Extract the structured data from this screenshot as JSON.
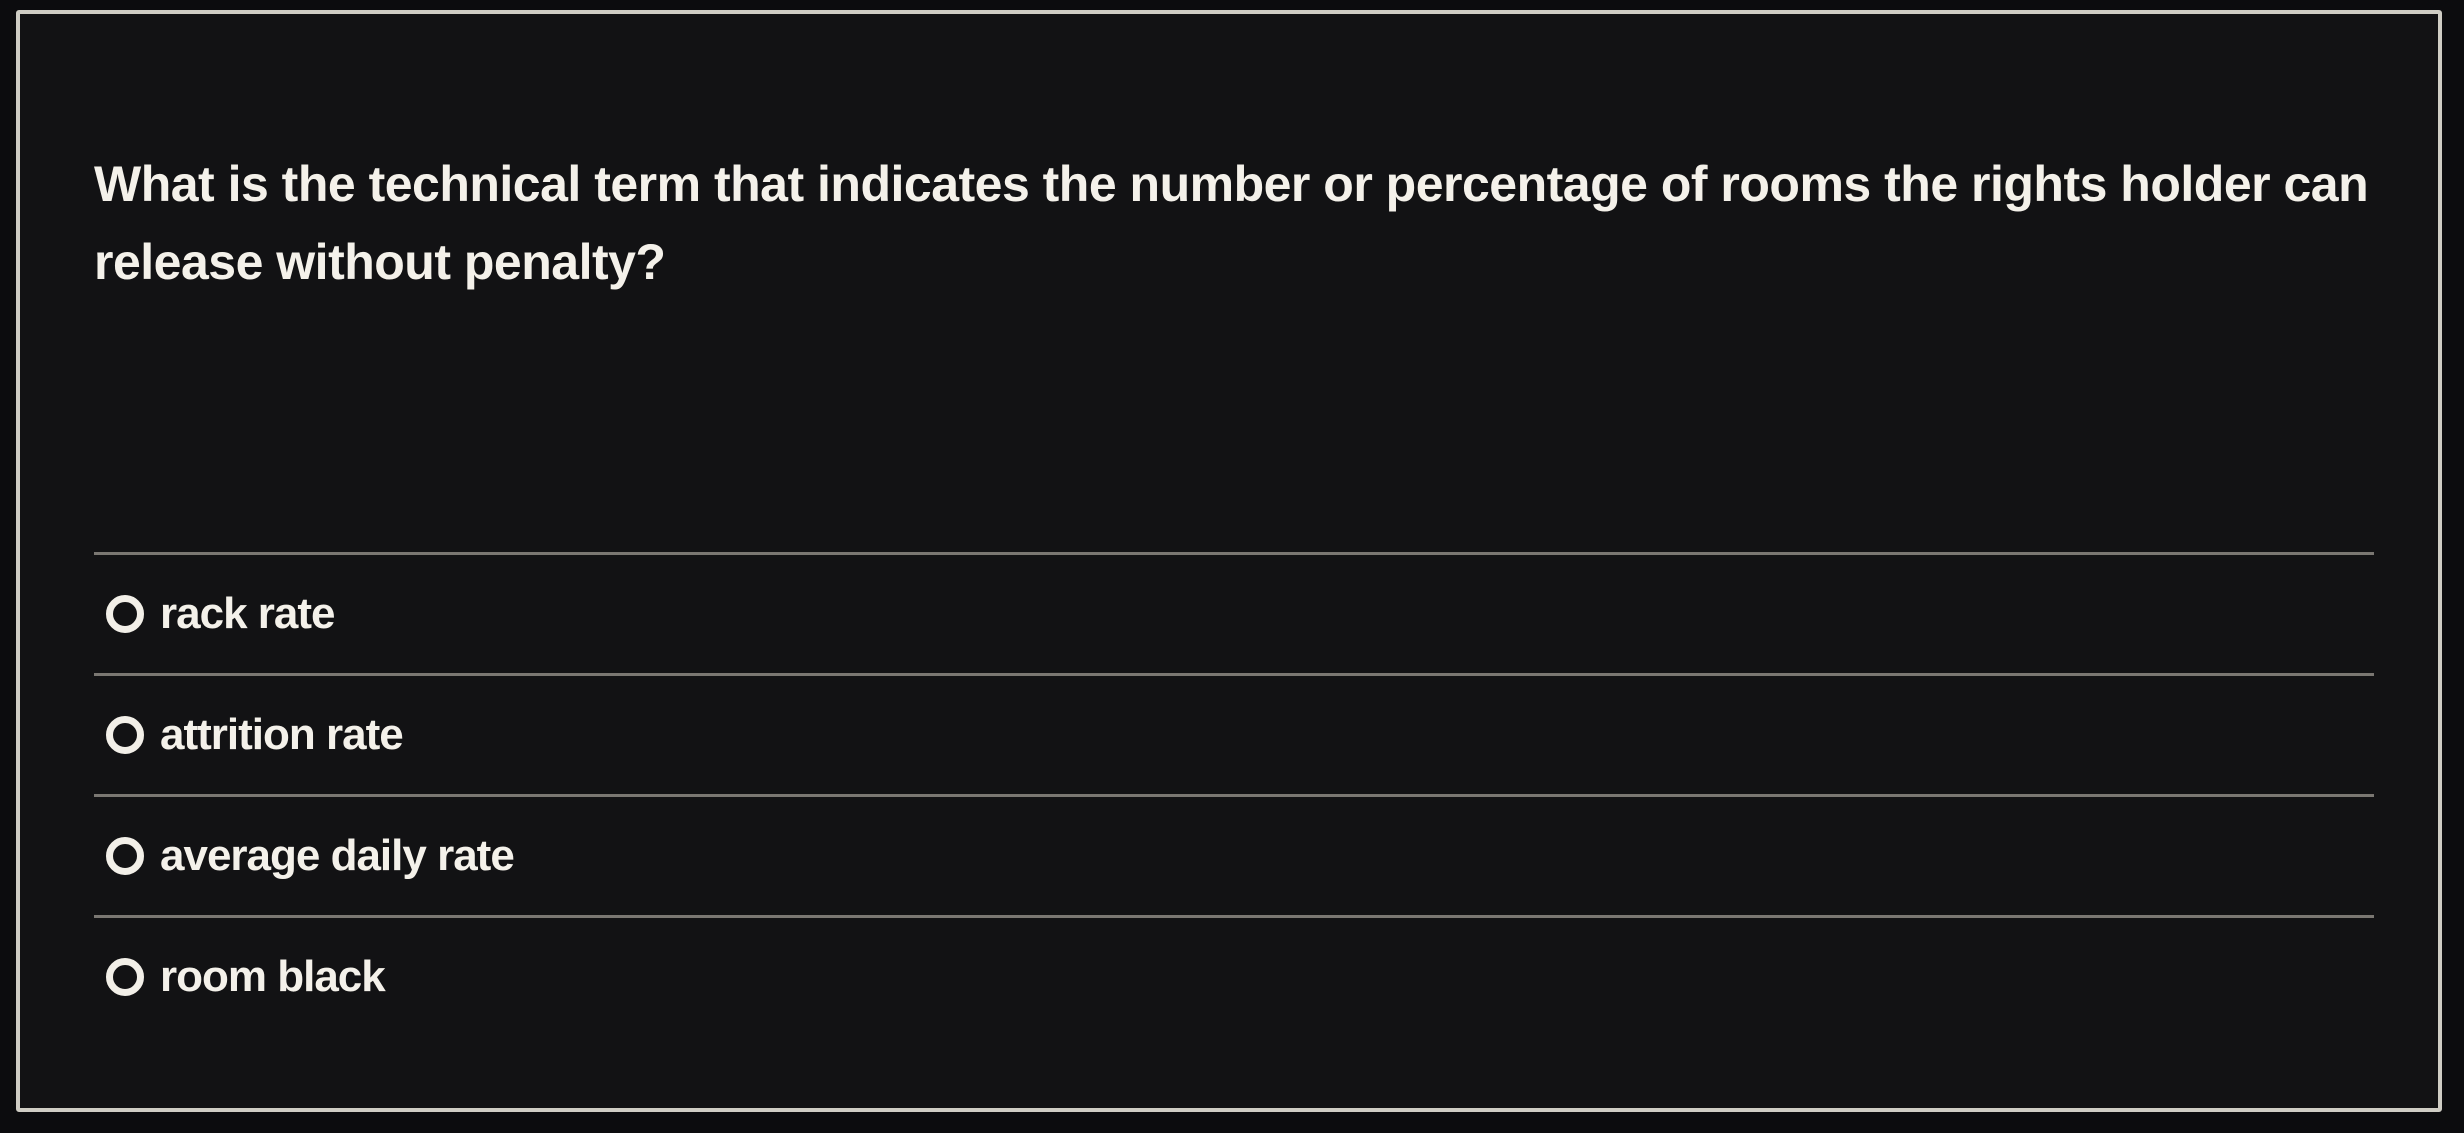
{
  "question": {
    "text": "What is the technical term that indicates the number or percentage of rooms the rights holder can release without penalty?"
  },
  "options": [
    {
      "label": "rack rate",
      "selected": false
    },
    {
      "label": "attrition rate",
      "selected": false
    },
    {
      "label": "average daily rate",
      "selected": false
    },
    {
      "label": "room black",
      "selected": false
    }
  ],
  "colors": {
    "background": "#0c0c0e",
    "text": "#f4f1ea",
    "frame_border": "#cfcdc4",
    "divider": "#8d8a82"
  }
}
